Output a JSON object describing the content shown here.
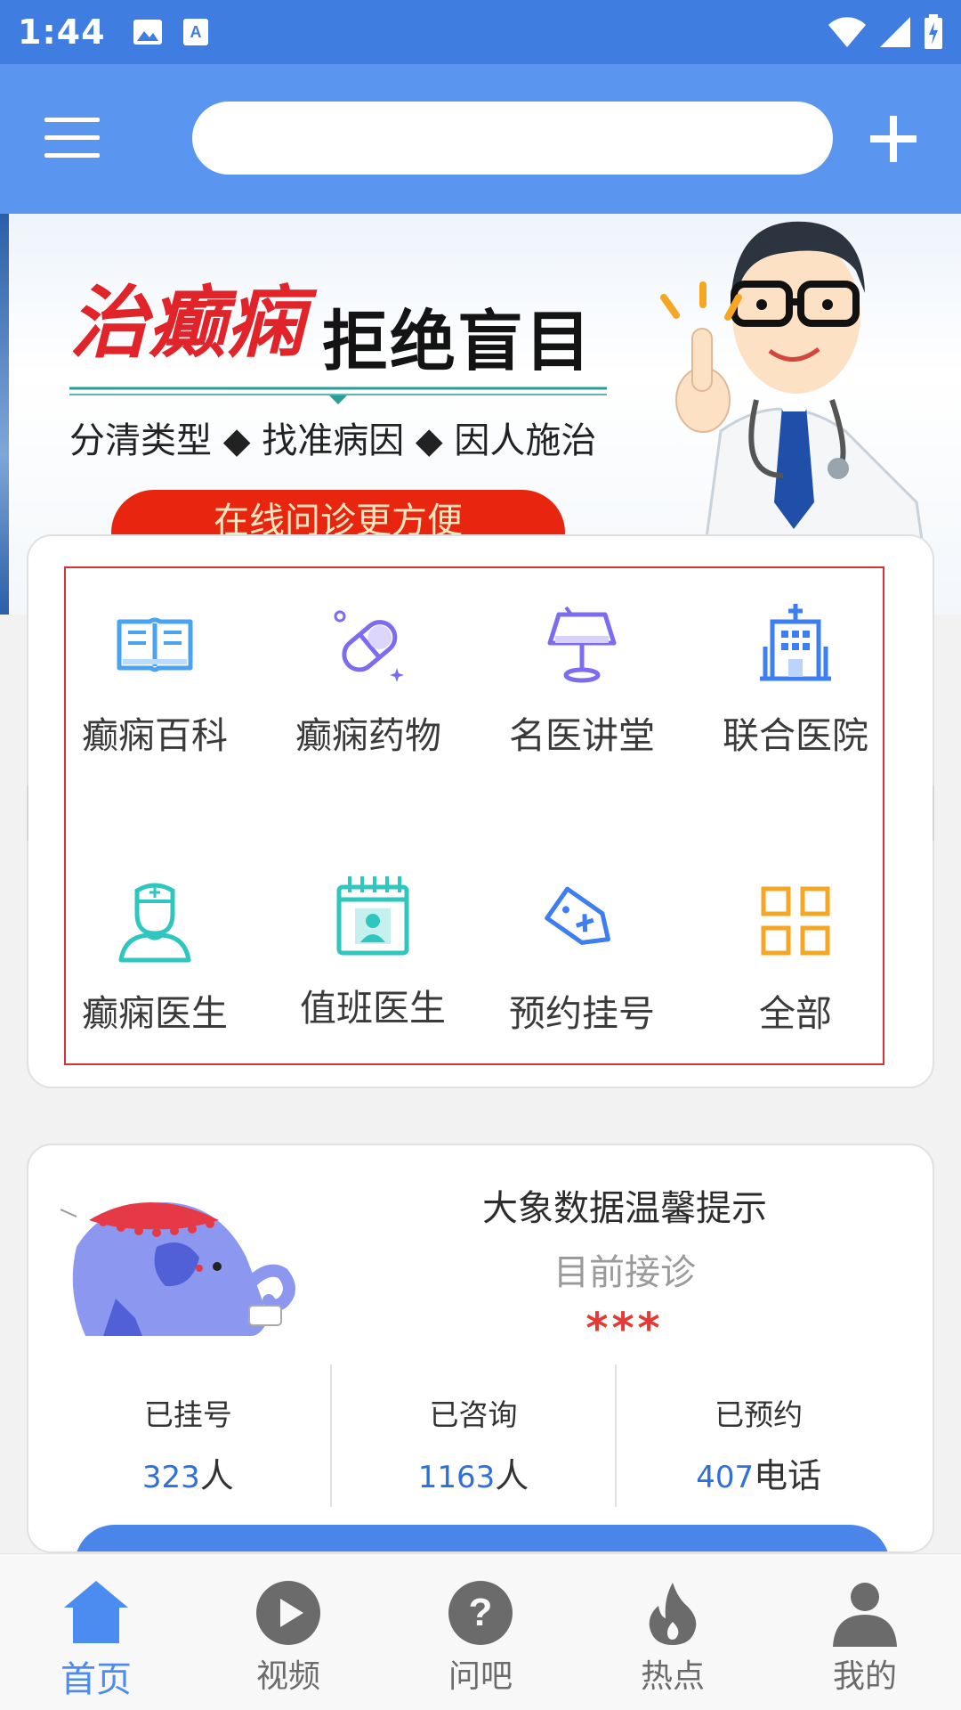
{
  "status_bar": {
    "time": "1:44",
    "icons": [
      "image-icon",
      "text-a-icon",
      "wifi-icon",
      "signal-icon",
      "battery-charging-icon"
    ]
  },
  "app_bar": {
    "menu_icon": "hamburger-menu-icon",
    "search_placeholder": "",
    "add_icon": "plus-icon",
    "color": "#5a95f0"
  },
  "banner": {
    "title_red": "治癫痫",
    "title_black": "拒绝盲目",
    "subtitle": "分清类型 ◆ 找准病因 ◆ 因人施治",
    "cta": "在线问诊更方便"
  },
  "categories": [
    {
      "label": "癫痫百科",
      "icon": "open-book-icon"
    },
    {
      "label": "癫痫药物",
      "icon": "capsule-icon"
    },
    {
      "label": "名医讲堂",
      "icon": "lamp-icon"
    },
    {
      "label": "联合医院",
      "icon": "hospital-icon"
    },
    {
      "label": "癫痫医生",
      "icon": "doctor-icon"
    },
    {
      "label": "值班医生",
      "icon": "calendar-person-icon"
    },
    {
      "label": "预约挂号",
      "icon": "tag-icon"
    },
    {
      "label": "全部",
      "icon": "grid-icon"
    }
  ],
  "info": {
    "title": "大象数据温馨提示",
    "subtitle": "目前接诊",
    "stars": "***",
    "stats": [
      {
        "label": "已挂号",
        "value": "323",
        "unit": "人"
      },
      {
        "label": "已咨询",
        "value": "1163",
        "unit": "人"
      },
      {
        "label": "已预约",
        "value": "407",
        "unit": "电话"
      }
    ]
  },
  "bottom_nav": [
    {
      "label": "首页",
      "icon": "home-icon",
      "active": true
    },
    {
      "label": "视频",
      "icon": "play-icon",
      "active": false
    },
    {
      "label": "问吧",
      "icon": "question-icon",
      "active": false
    },
    {
      "label": "热点",
      "icon": "flame-icon",
      "active": false
    },
    {
      "label": "我的",
      "icon": "person-icon",
      "active": false
    }
  ],
  "colors": {
    "primary_blue": "#5a95f0",
    "active_blue": "#4a8cf0",
    "number_blue": "#2f6fd6",
    "accent_red": "#e53935",
    "icon_blue": "#4aa3f0",
    "icon_purple": "#7c6cf0",
    "icon_teal": "#2fc6c0",
    "icon_orange": "#f5a623"
  }
}
